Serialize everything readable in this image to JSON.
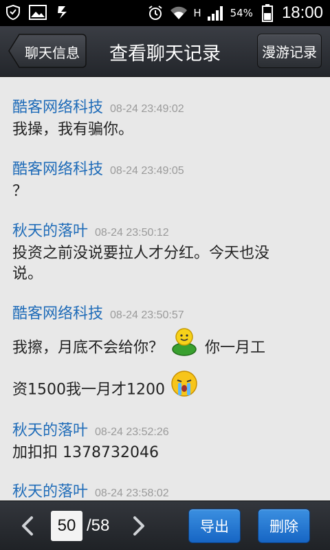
{
  "status_bar": {
    "network_type": "H",
    "battery": "54%",
    "time": "18:00"
  },
  "header": {
    "back_label": "聊天信息",
    "title": "查看聊天记录",
    "roam_label": "漫游记录"
  },
  "messages": [
    {
      "sender": "酷客网络科技",
      "time": "08-24 23:49:02",
      "text": "我操，我有骗你。"
    },
    {
      "sender": "酷客网络科技",
      "time": "08-24 23:49:05",
      "text": "？"
    },
    {
      "sender": "秋天的落叶",
      "time": "08-24 23:50:12",
      "text_line1": "投资之前没说要拉人才分红。今天也没",
      "text_line2": "说。"
    },
    {
      "sender": "酷客网络科技",
      "time": "08-24 23:50:57",
      "text_part1": "我擦，月底不会给你？",
      "text_part2": "你一月工",
      "text_part3": "资1500我一月才1200",
      "emoji1": "smiley-green-shirt-icon",
      "emoji2": "crying-face-icon"
    },
    {
      "sender": "秋天的落叶",
      "time": "08-24 23:52:26",
      "text": "加扣扣 1378732046"
    },
    {
      "sender": "秋天的落叶",
      "time": "08-24 23:58:02"
    }
  ],
  "footer": {
    "current_page": "50",
    "total_pages": "/58",
    "export_label": "导出",
    "delete_label": "删除"
  },
  "colors": {
    "sender": "#1e6bb8",
    "timestamp": "#9a9a9a",
    "background": "#e8e8e8",
    "button_blue": "#1f72d0"
  }
}
